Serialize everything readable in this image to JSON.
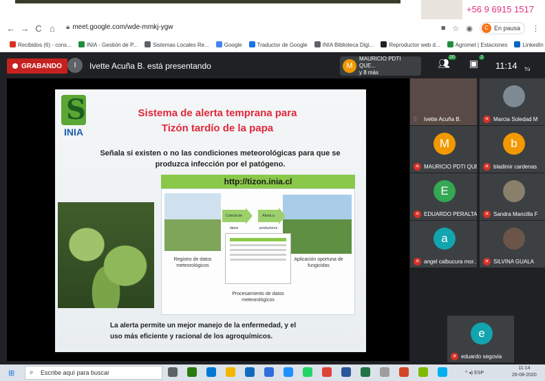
{
  "top": {
    "phone": "+56 9 6915 1517"
  },
  "browser": {
    "url": "meet.google.com/wde-mmkj-ygw",
    "pause_label": "En pausa",
    "bookmarks": [
      {
        "label": "Recibidos (6) - cons...",
        "color": "#d93025"
      },
      {
        "label": "INIA - Gestión de P...",
        "color": "#1e8e3e"
      },
      {
        "label": "Sistemas Locales Re...",
        "color": "#5f6368"
      },
      {
        "label": "Google",
        "color": "#4285f4"
      },
      {
        "label": "Traductor de Google",
        "color": "#1a73e8"
      },
      {
        "label": "INIA Biblioteca Digi...",
        "color": "#5f6368"
      },
      {
        "label": "Reproductor web d...",
        "color": "#202124"
      },
      {
        "label": "Agromet | Estaciones",
        "color": "#1e8e3e"
      },
      {
        "label": "LinkedIn",
        "color": "#0a66c2"
      }
    ]
  },
  "meet": {
    "recording_label": "GRABANDO",
    "presenter_initial": "I",
    "presenter_text": "Ivette Acuña B. está presentando",
    "speaker_initial": "M",
    "speaker_name": "MAURICIO PDTI QUE...",
    "speaker_more": "y 8 más",
    "participants_count": "20",
    "chat_count": "2",
    "time": "11:14",
    "you_label": "Tú"
  },
  "slide": {
    "logo_text": "INIA",
    "title_line1": "Sistema de alerta temprana para",
    "title_line2": "Tizón tardío de la papa",
    "subtitle_line1": "Señala si existen o no las condiciones meteorológicas para que se",
    "subtitle_line2": "produzca infección por el patógeno.",
    "url": "http://tizon.inia.cl",
    "arrow1": "Colecta de datos",
    "arrow2": "Alerta a productores",
    "caption_left": "Registro de datos meteorológicos",
    "caption_right": "Aplicación oportuna de fungicidas",
    "caption_bottom": "Procesamiento de datos meteorológicos",
    "footer_line1": "La alerta permite un mejor manejo de la enfermedad, y el",
    "footer_line2": "uso más eficiente y racional de los agroquímicos."
  },
  "participants": [
    {
      "name": "Ivette Acuña B.",
      "initial": "",
      "color": "#5a4a45",
      "muted": false
    },
    {
      "name": "Marcia Soledad M",
      "initial": "",
      "color": "#7d8a94",
      "muted": true
    },
    {
      "name": "MAURICIO PDTI QUE...",
      "initial": "M",
      "color": "#f29900",
      "muted": true
    },
    {
      "name": "bladimir cardenas",
      "initial": "b",
      "color": "#f29900",
      "muted": true
    },
    {
      "name": "EDUARDO PERALTA ...",
      "initial": "E",
      "color": "#34a853",
      "muted": true
    },
    {
      "name": "Sandra Mancilla F",
      "initial": "",
      "color": "#8a7f6a",
      "muted": true
    },
    {
      "name": "angel calbucura mor...",
      "initial": "a",
      "color": "#12a4af",
      "muted": true
    },
    {
      "name": "SILVINA GUALA",
      "initial": "",
      "color": "#6a5548",
      "muted": true
    },
    {
      "name": "eduardo segovia",
      "initial": "e",
      "color": "#12a4af",
      "muted": true
    }
  ],
  "taskbar": {
    "search_placeholder": "Escribe aquí para buscar",
    "lang": "ESP",
    "time": "11:14",
    "date": "26-08-2020"
  }
}
